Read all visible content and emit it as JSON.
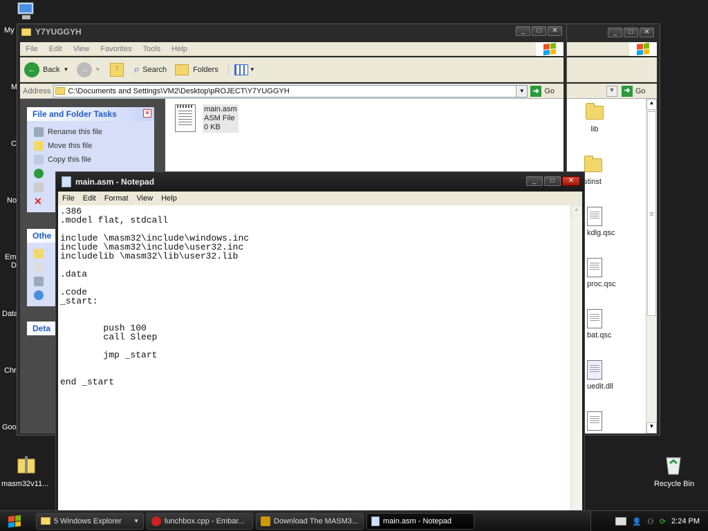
{
  "desktop": {
    "edge_labels": [
      "My",
      "M",
      "C",
      "No",
      "Em",
      "D",
      "Data",
      "Chr",
      "Goo"
    ],
    "masm_icon_label": "masm32v11...",
    "recycle_label": "Recycle Bin"
  },
  "explorer": {
    "title": "Y7YUGGYH",
    "menu": [
      "File",
      "Edit",
      "View",
      "Favorites",
      "Tools",
      "Help"
    ],
    "toolbar": {
      "back": "Back",
      "search": "Search",
      "folders": "Folders"
    },
    "address_label": "Address",
    "address_value": "C:\\Documents and Settings\\VM2\\Desktop\\pROJECT\\Y7YUGGYH",
    "go": "Go",
    "file": {
      "name": "main.asm",
      "type": "ASM File",
      "size": "0 KB"
    },
    "tasks_title": "File and Folder Tasks",
    "tasks": [
      "Rename this file",
      "Move this file",
      "Copy this file"
    ],
    "other_title": "Othe",
    "details_title": "Deta"
  },
  "explorer2": {
    "go": "Go",
    "items": [
      "lib",
      "estinst",
      "kdlg.qsc",
      "proc.qsc",
      "bat.qsc",
      "uedit.dll"
    ]
  },
  "notepad": {
    "title": "main.asm - Notepad",
    "menu": [
      "File",
      "Edit",
      "Format",
      "View",
      "Help"
    ],
    "text": ".386\n.model flat, stdcall\n\ninclude \\masm32\\include\\windows.inc\ninclude \\masm32\\include\\user32.inc\nincludelib \\masm32\\lib\\user32.lib\n\n.data\n\n.code\n_start:\n\n\n\tpush 100\n\tcall Sleep\n\n\tjmp _start\n\n\nend _start"
  },
  "taskbar": {
    "items": [
      "5 Windows Explorer",
      "lunchbox.cpp - Embar...",
      "Download The MASM3...",
      "main.asm - Notepad"
    ],
    "clock": "2:24 PM"
  }
}
